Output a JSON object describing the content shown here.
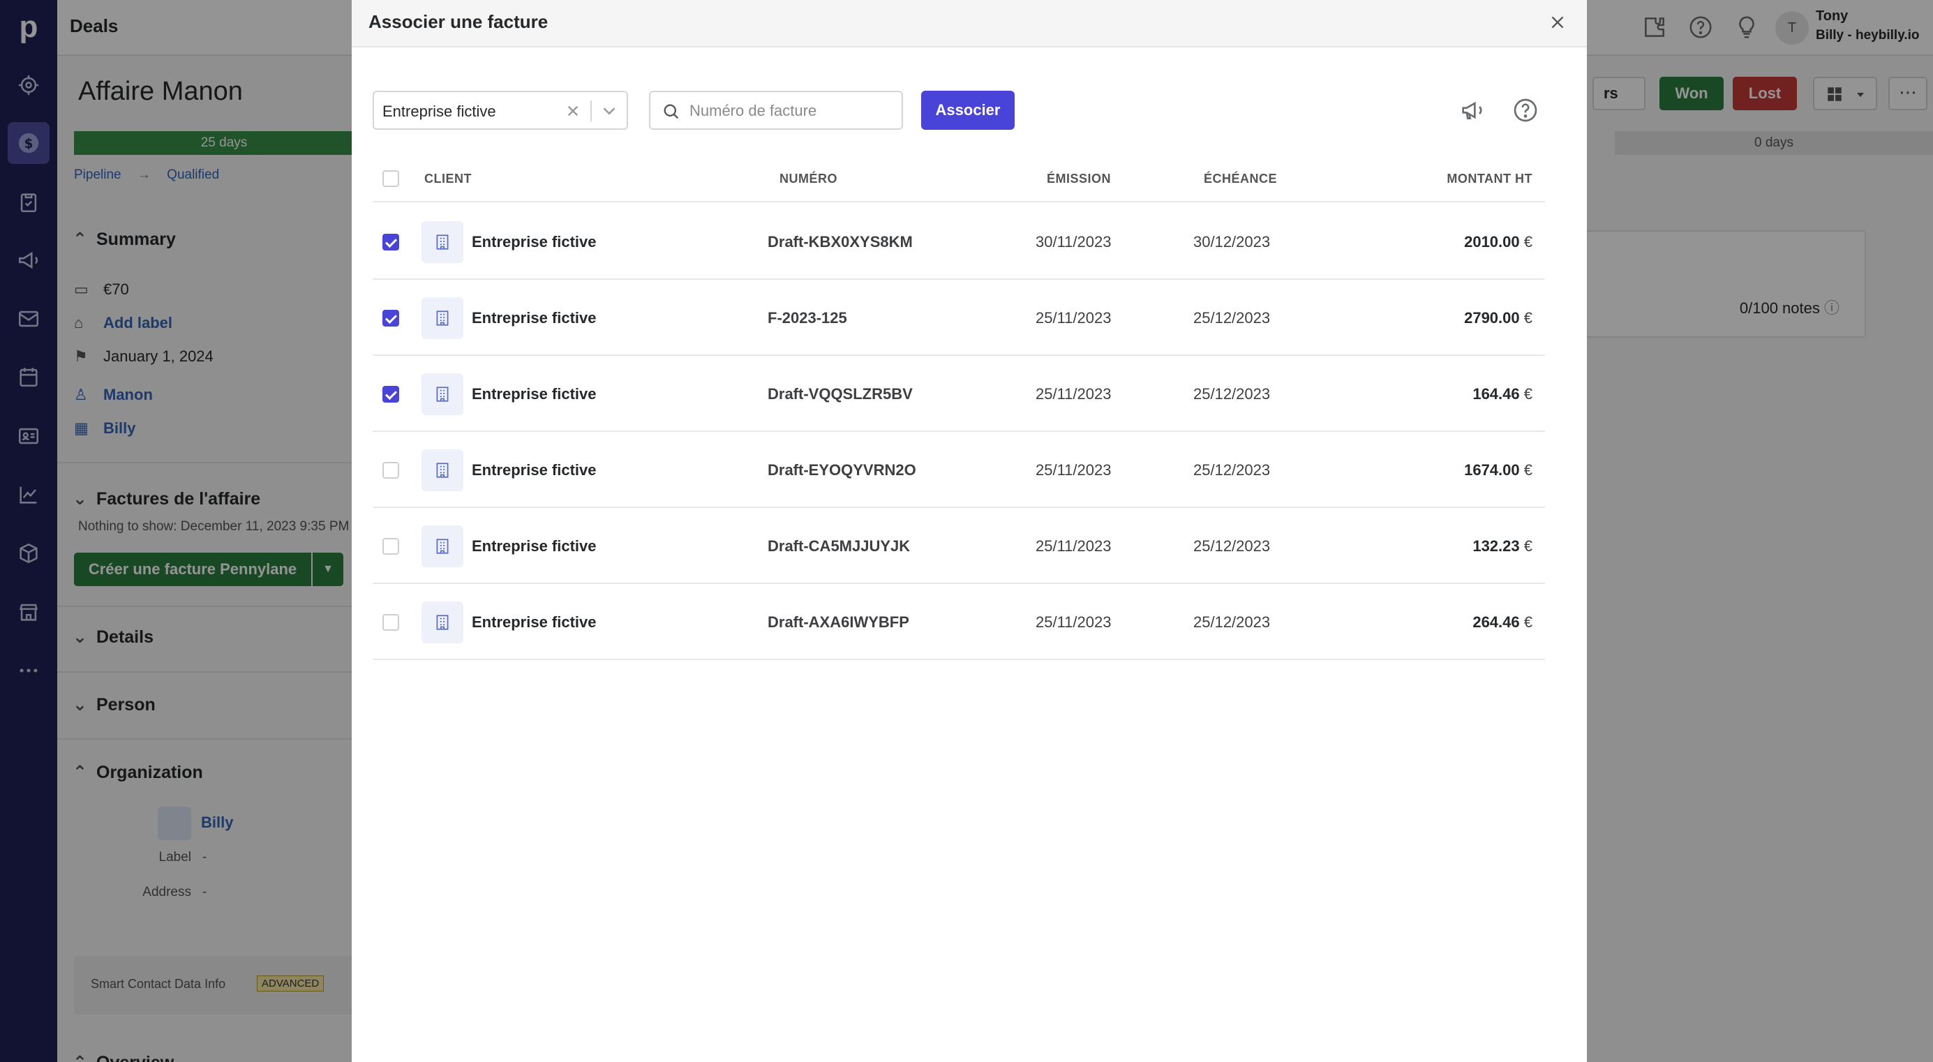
{
  "app": {
    "title": "Deals"
  },
  "user": {
    "initial": "T",
    "name": "Tony",
    "company": "Billy - heybilly.io"
  },
  "deal": {
    "title": "Affaire Manon",
    "stage_done_label": "25 days",
    "stage_rest_label": "0 days",
    "breadcrumb": [
      "Pipeline",
      "Qualified"
    ],
    "won_label": "Won",
    "lost_label": "Lost",
    "follow_label": "rs",
    "notes_count": "0/100 notes"
  },
  "summary": {
    "header": "Summary",
    "value": "€70",
    "add_label": "Add label",
    "date": "January 1, 2024",
    "person": "Manon",
    "org": "Billy"
  },
  "factures": {
    "header": "Factures de l'affaire",
    "note": "Nothing to show: December 11, 2023 9:35 PM",
    "create_label": "Créer une facture Pennylane"
  },
  "sections": {
    "details": "Details",
    "person": "Person",
    "organization": "Organization",
    "overview": "Overview"
  },
  "organization": {
    "name": "Billy",
    "label_key": "Label",
    "label_val": "-",
    "address_key": "Address",
    "address_val": "-"
  },
  "smart_contact": {
    "text": "Smart Contact Data Info",
    "badge": "ADVANCED"
  },
  "modal": {
    "title": "Associer une facture",
    "client_filter": "Entreprise fictive",
    "search_placeholder": "Numéro de facture",
    "associate_label": "Associer",
    "columns": {
      "client": "CLIENT",
      "numero": "NUMÉRO",
      "emission": "ÉMISSION",
      "echeance": "ÉCHÉANCE",
      "montant": "MONTANT HT"
    },
    "currency": "€",
    "rows": [
      {
        "checked": true,
        "client": "Entreprise fictive",
        "numero": "Draft-KBX0XYS8KM",
        "emission": "30/11/2023",
        "echeance": "30/12/2023",
        "montant": "2010.00"
      },
      {
        "checked": true,
        "client": "Entreprise fictive",
        "numero": "F-2023-125",
        "emission": "25/11/2023",
        "echeance": "25/12/2023",
        "montant": "2790.00"
      },
      {
        "checked": true,
        "client": "Entreprise fictive",
        "numero": "Draft-VQQSLZR5BV",
        "emission": "25/11/2023",
        "echeance": "25/12/2023",
        "montant": "164.46"
      },
      {
        "checked": false,
        "client": "Entreprise fictive",
        "numero": "Draft-EYOQYVRN2O",
        "emission": "25/11/2023",
        "echeance": "25/12/2023",
        "montant": "1674.00"
      },
      {
        "checked": false,
        "client": "Entreprise fictive",
        "numero": "Draft-CA5MJJUYJK",
        "emission": "25/11/2023",
        "echeance": "25/12/2023",
        "montant": "132.23"
      },
      {
        "checked": false,
        "client": "Entreprise fictive",
        "numero": "Draft-AXA6IWYBFP",
        "emission": "25/11/2023",
        "echeance": "25/12/2023",
        "montant": "264.46"
      }
    ]
  },
  "colors": {
    "nav_bg": "#1f2056",
    "primary": "#4943d8",
    "won": "#2c7d3e",
    "lost": "#c33a38",
    "link": "#3364b7"
  },
  "icons": {
    "nav": [
      "pipedrive-logo",
      "target-icon",
      "dollar-icon",
      "clipboard-icon",
      "megaphone-icon",
      "mail-icon",
      "calendar-icon",
      "contacts-icon",
      "chart-icon",
      "box-icon",
      "store-icon",
      "more-icon"
    ],
    "modal": [
      "close-icon",
      "search-icon",
      "megaphone-icon",
      "help-icon",
      "building-icon"
    ]
  }
}
